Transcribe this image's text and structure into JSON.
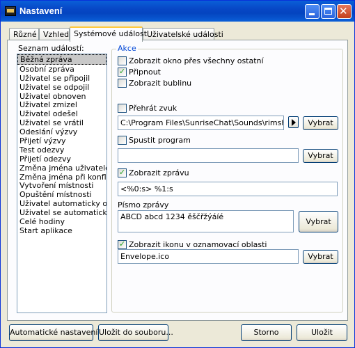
{
  "window": {
    "title": "Nastavení"
  },
  "tabs": [
    "Různé",
    "Vzhled",
    "Systémové události",
    "Uživatelské události"
  ],
  "events": {
    "label": "Seznam událostí:",
    "items": [
      "Běžná zpráva",
      "Osobní zpráva",
      "Uživatel se připojil",
      "Uživatel se odpojil",
      "Uživatel obnoven",
      "Uživatel zmizel",
      "Uživatel odešel",
      "Uživatel se vrátil",
      "Odeslání výzvy",
      "Přijetí výzvy",
      "Test odezvy",
      "Přijetí odezvy",
      "Změna jména uživatele",
      "Změna jména při konfliktu",
      "Vytvoření místnosti",
      "Opuštění místnosti",
      "Uživatel automaticky odešel",
      "Uživatel se automaticky vrátil",
      "Celé hodiny",
      "Start aplikace"
    ],
    "selected_index": 0
  },
  "actions": {
    "title": "Akce",
    "show_on_top": {
      "label": "Zobrazit okno přes všechny ostatní",
      "checked": false
    },
    "pin": {
      "label": "Připnout",
      "checked": true
    },
    "show_bubble": {
      "label": "Zobrazit bublinu",
      "checked": false
    },
    "play_sound": {
      "label": "Přehrát zvuk",
      "checked": false,
      "path": "C:\\Program Files\\SunriseChat\\Sounds\\rimshot.w",
      "browse_label": "Vybrat"
    },
    "run_program": {
      "label": "Spustit program",
      "checked": false,
      "path": "",
      "browse_label": "Vybrat"
    },
    "show_message": {
      "label": "Zobrazit zprávu",
      "checked": true,
      "text": "<%0:s> %1:s"
    },
    "font": {
      "label": "Písmo zprávy",
      "preview": "ABCD abcd 1234 ěščřžýáíé",
      "browse_label": "Vybrat"
    },
    "tray_icon": {
      "label": "Zobrazit ikonu v oznamovací oblasti",
      "checked": true,
      "file": "Envelope.ico",
      "browse_label": "Vybrat"
    }
  },
  "footer": {
    "auto_settings": "Automatické nastavení",
    "save_to_file": "Uložit do souboru...",
    "cancel": "Storno",
    "save": "Uložit"
  },
  "colors": {
    "title_bar": "#0a5fd8",
    "group_title": "#0046d5",
    "checkmark": "#21a121"
  }
}
